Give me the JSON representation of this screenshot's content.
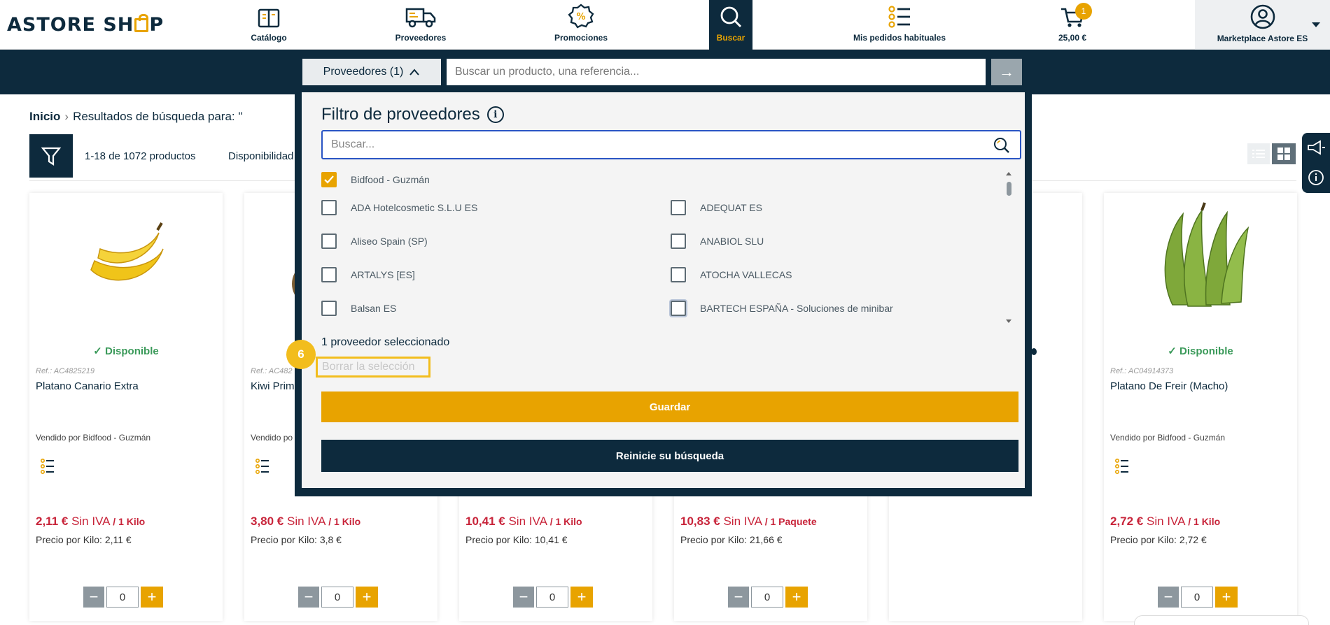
{
  "header": {
    "logo": "ASTORE SH",
    "logo_tail": "P",
    "nav": [
      {
        "label": "Catálogo",
        "icon": "book-icon"
      },
      {
        "label": "Proveedores",
        "icon": "truck-icon"
      },
      {
        "label": "Promociones",
        "icon": "percent-badge-icon"
      },
      {
        "label": "Buscar",
        "icon": "search-icon"
      },
      {
        "label": "Mis pedidos habituales",
        "icon": "list-icon"
      },
      {
        "label": "25,00 €",
        "icon": "cart-icon",
        "badge": "1"
      }
    ],
    "account_label": "Marketplace Astore ES"
  },
  "search": {
    "providers_button": "Proveedores (1)",
    "placeholder": "Buscar un producto, una referencia...",
    "go_symbol": "→"
  },
  "breadcrumb": {
    "home": "Inicio",
    "current": "Resultados de búsqueda para: ''"
  },
  "toolbar": {
    "count": "1-18 de 1072 productos",
    "availability": "Disponibilidad"
  },
  "products": [
    {
      "available": "Disponible",
      "ref": "Ref.: AC4825219",
      "name": "Platano Canario Extra",
      "seller": "Vendido por Bidfood - Guzmán",
      "price": "2,11 €",
      "tax": "Sin IVA",
      "unit": "/ 1 Kilo",
      "per_kilo": "Precio por Kilo: 2,11 €",
      "qty": "0"
    },
    {
      "available": "",
      "ref": "Ref.: AC482",
      "name": "Kiwi Prim",
      "seller": "Vendido po",
      "price": "3,80 €",
      "tax": "Sin IVA",
      "unit": "/ 1 Kilo",
      "per_kilo": "Precio por Kilo: 3,8 €",
      "qty": "0"
    },
    {
      "available": "",
      "ref": "",
      "name": "",
      "seller": "",
      "price": "10,41 €",
      "tax": "Sin IVA",
      "unit": "/ 1 Kilo",
      "per_kilo": "Precio por Kilo: 10,41 €",
      "qty": "0"
    },
    {
      "available": "",
      "ref": "",
      "name": "",
      "seller": "",
      "price": "10,83 €",
      "tax": "Sin IVA",
      "unit": "/ 1 Paquete",
      "per_kilo": "Precio por Kilo: 21,66 €",
      "qty": "0"
    },
    {
      "available": "Disponible",
      "ref": "Ref.: AC04914373",
      "name": "Platano De Freir (Macho)",
      "seller": "Vendido por Bidfood - Guzmán",
      "price": "2,72 €",
      "tax": "Sin IVA",
      "unit": "/ 1 Kilo",
      "per_kilo": "Precio por Kilo: 2,72 €",
      "qty": "0"
    }
  ],
  "filter_panel": {
    "title": "Filtro de proveedores",
    "search_placeholder": "Buscar...",
    "options": [
      {
        "label": "Bidfood - Guzmán",
        "checked": true
      },
      {
        "label": "ADA Hotelcosmetic S.L.U ES",
        "checked": false
      },
      {
        "label": "ADEQUAT ES",
        "checked": false
      },
      {
        "label": "Aliseo Spain (SP)",
        "checked": false
      },
      {
        "label": "ANABIOL SLU",
        "checked": false
      },
      {
        "label": "ARTALYS [ES]",
        "checked": false
      },
      {
        "label": "ATOCHA VALLECAS",
        "checked": false
      },
      {
        "label": "Balsan ES",
        "checked": false
      },
      {
        "label": "BARTECH ESPAÑA - Soluciones de minibar",
        "checked": false
      }
    ],
    "selected_count": "1 proveedor seleccionado",
    "clear_selection": "Borrar la selección",
    "save": "Guardar",
    "reset": "Reinicie su búsqueda",
    "step_badge": "6"
  },
  "colors": {
    "navy": "#0d2a3d",
    "accent": "#e8a300",
    "price_red": "#c8243a",
    "available_green": "#3b9a5a"
  }
}
